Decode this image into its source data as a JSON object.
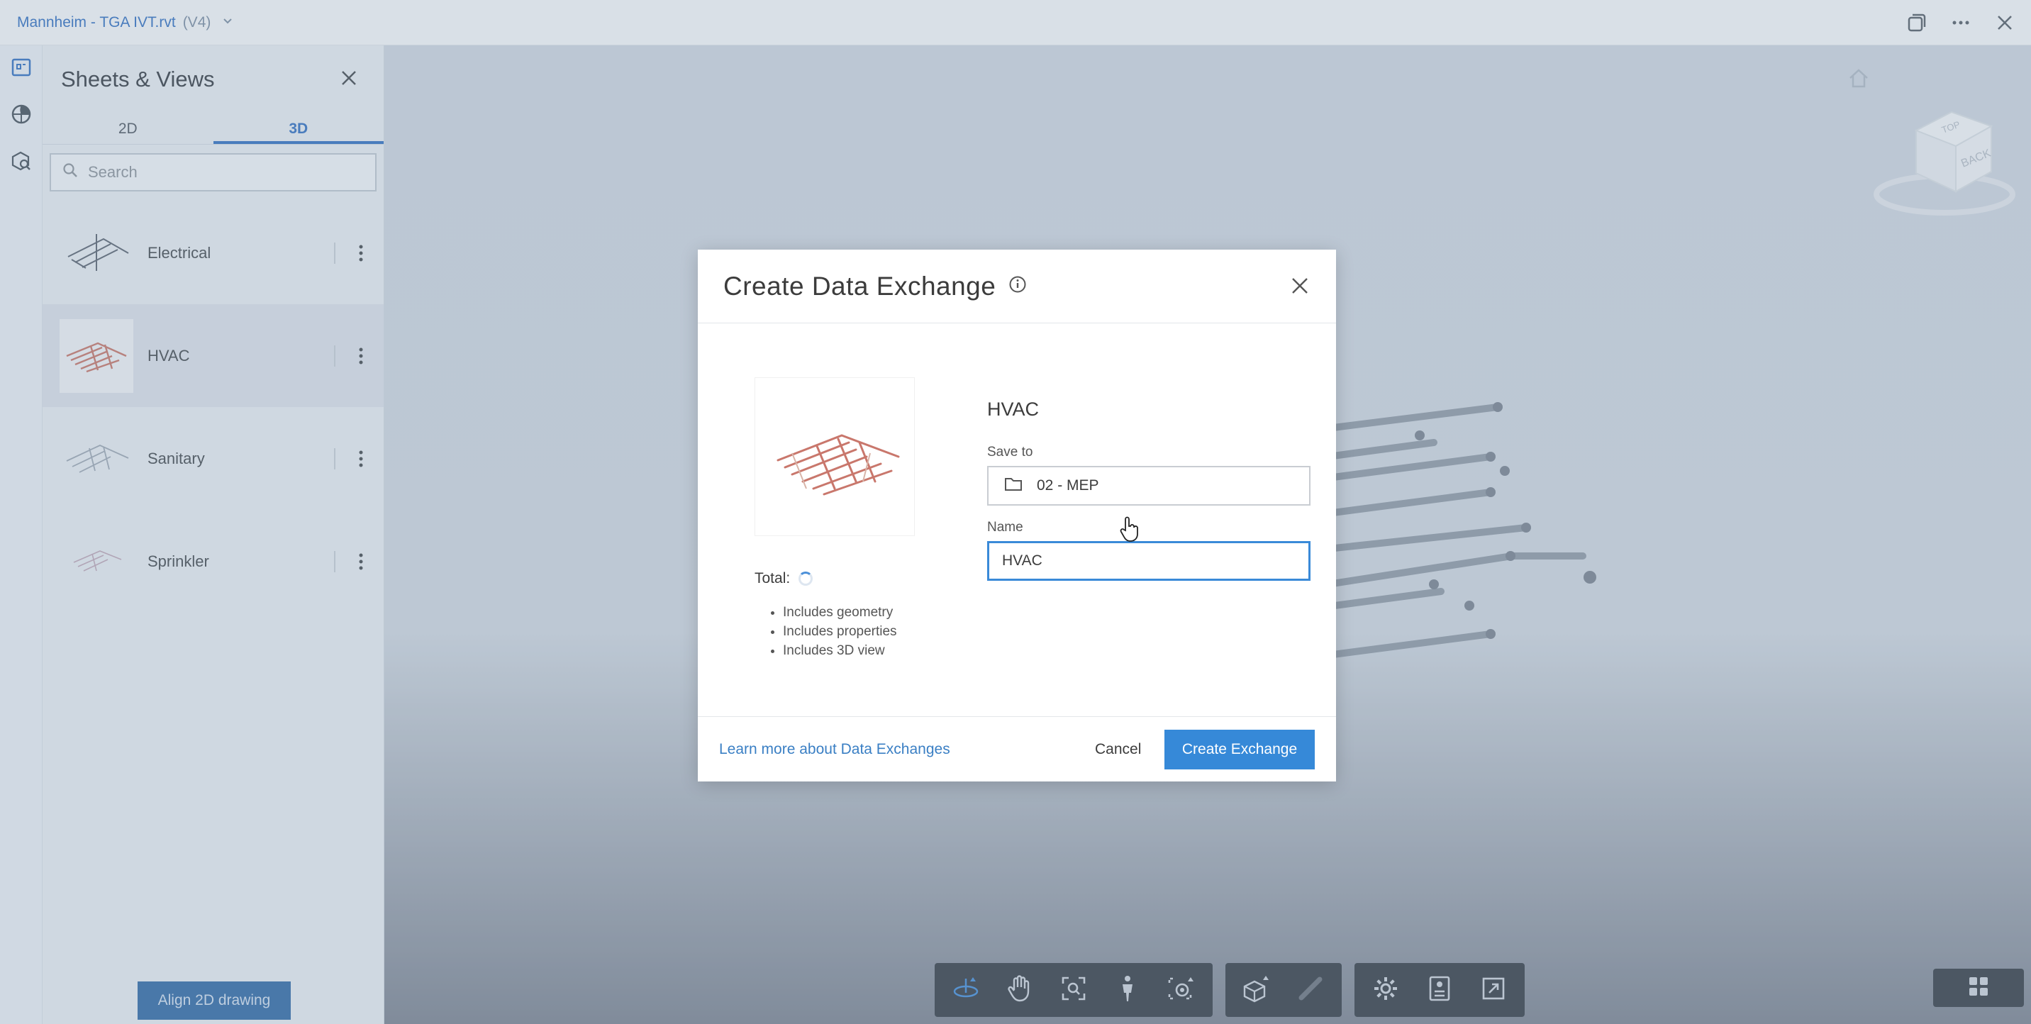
{
  "topbar": {
    "file_name": "Mannheim - TGA IVT.rvt",
    "version": "(V4)"
  },
  "sidebar": {
    "title": "Sheets & Views",
    "tabs": [
      {
        "label": "2D",
        "active": false
      },
      {
        "label": "3D",
        "active": true
      }
    ],
    "search_placeholder": "Search",
    "items": [
      {
        "label": "Electrical",
        "selected": false
      },
      {
        "label": "HVAC",
        "selected": true
      },
      {
        "label": "Sanitary",
        "selected": false
      },
      {
        "label": "Sprinkler",
        "selected": false
      }
    ],
    "align_button": "Align 2D drawing"
  },
  "viewcube": {
    "back_label": "BACK",
    "top_label": "TOP"
  },
  "modal": {
    "title": "Create Data Exchange",
    "view_name": "HVAC",
    "total_label": "Total:",
    "includes": [
      "Includes geometry",
      "Includes properties",
      "Includes 3D view"
    ],
    "save_to_label": "Save to",
    "save_to_value": "02 - MEP",
    "name_label": "Name",
    "name_value": "HVAC",
    "learn_more": "Learn more about Data Exchanges",
    "cancel": "Cancel",
    "create": "Create Exchange"
  },
  "colors": {
    "accent": "#3689d8",
    "link": "#3a7fc4",
    "toolbar_bg": "#3d4752"
  }
}
